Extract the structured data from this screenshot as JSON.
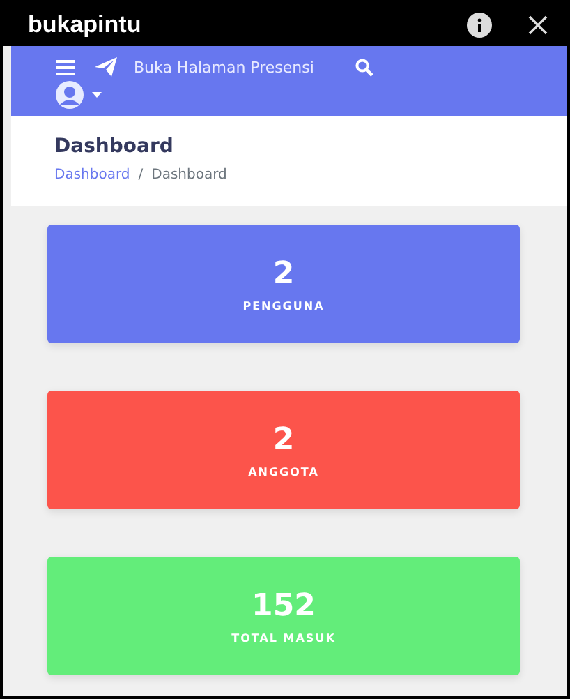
{
  "window": {
    "title": "bukapintu"
  },
  "navbar": {
    "link": "Buka Halaman Presensi"
  },
  "header": {
    "title": "Dashboard",
    "breadcrumb": [
      "Dashboard",
      "Dashboard"
    ],
    "separator": "/"
  },
  "cards": [
    {
      "value": "2",
      "label": "PENGGUNA",
      "color": "#6777ef"
    },
    {
      "value": "2",
      "label": "ANGGOTA",
      "color": "#fc544b"
    },
    {
      "value": "152",
      "label": "TOTAL MASUK",
      "color": "#63ed7a"
    }
  ]
}
